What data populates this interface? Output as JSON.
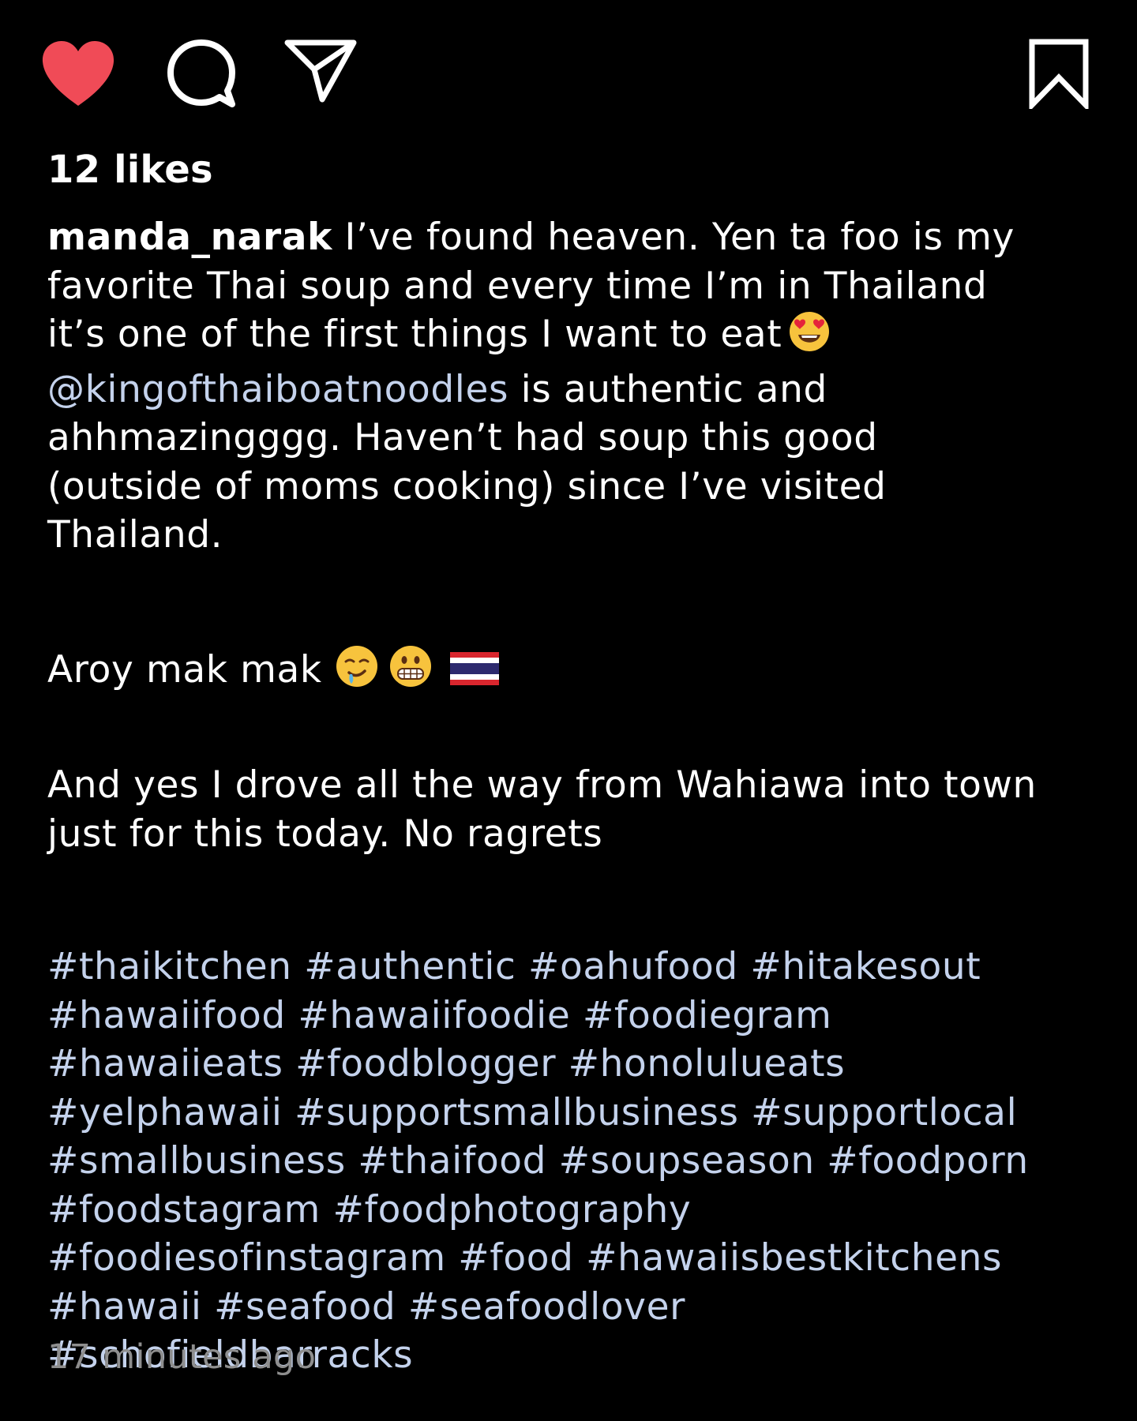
{
  "icons": {
    "like": "heart-filled-icon",
    "comment": "comment-bubble-icon",
    "share": "paper-plane-icon",
    "save": "bookmark-icon"
  },
  "colors": {
    "background": "#000000",
    "text": "#ffffff",
    "like_active": "#f04b57",
    "link": "#c4d2ec",
    "timestamp": "#8e8e8e"
  },
  "post": {
    "likes_text": "12 likes",
    "username": "manda_narak",
    "caption_lines": [
      " I’ve found heaven. Yen ta foo is my",
      "favorite Thai soup and every time I’m in Thailand",
      "it’s one of the first things I want to eat"
    ],
    "mention": "@kingofthaiboatnoodles",
    "caption_after_mention": " is authentic and",
    "caption_lines_2": [
      "ahhmazingggg. Haven’t had soup this good",
      "(outside of moms cooking) since I’ve visited",
      "Thailand."
    ],
    "aroy_text": "Aroy mak mak",
    "drive_lines": [
      "And yes I drove all the way from Wahiawa into town",
      "just for this today. No ragrets"
    ],
    "hashtag_lines": [
      "#thaikitchen #authentic #oahufood #hitakesout",
      "#hawaiifood #hawaiifoodie #foodiegram",
      "#hawaiieats #foodblogger #honolulueats",
      "#yelphawaii #supportsmallbusiness #supportlocal",
      "#smallbusiness #thaifood #soupseason #foodporn",
      "#foodstagram #foodphotography",
      "#foodiesofinstagram #food #hawaiisbestkitchens",
      "#hawaii #seafood #seafoodlover",
      "#schofieldbarracks"
    ],
    "timestamp": "17 minutes ago",
    "emojis": {
      "heart_eyes": "heart-eyes-emoji",
      "drooling": "drooling-face-emoji",
      "grimacing": "grimacing-face-emoji",
      "thai_flag": "thailand-flag-emoji"
    }
  }
}
